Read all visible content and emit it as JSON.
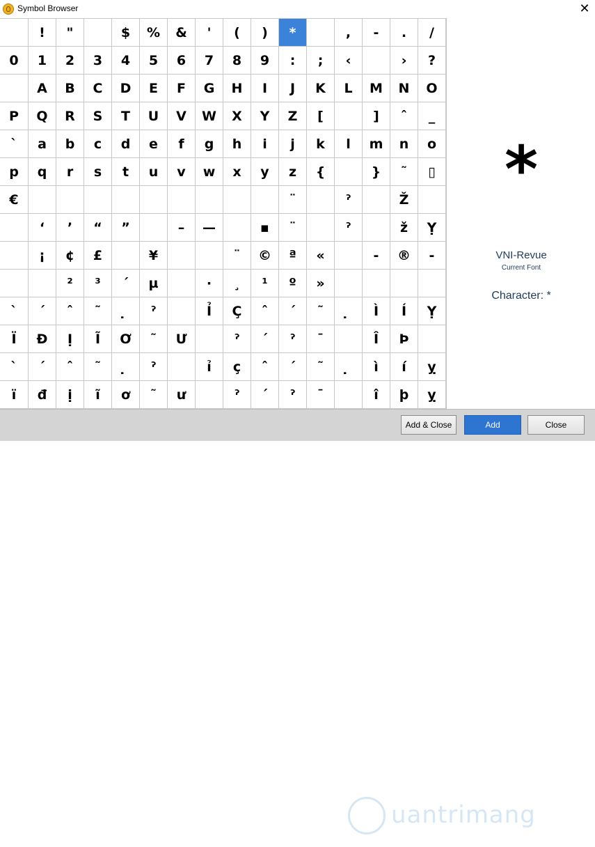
{
  "window": {
    "title": "Symbol Browser",
    "close_glyph": "✕",
    "app_icon": "symbol-browser-app-icon"
  },
  "grid": {
    "selected": {
      "row": 0,
      "col": 10
    },
    "rows": [
      [
        "",
        "!",
        "\"",
        "",
        "$",
        "%",
        "&",
        "'",
        "(",
        ")",
        "*",
        "",
        ",",
        "-",
        ".",
        "/"
      ],
      [
        "0",
        "1",
        "2",
        "3",
        "4",
        "5",
        "6",
        "7",
        "8",
        "9",
        ":",
        ";",
        "‹",
        "",
        "›",
        "?"
      ],
      [
        "",
        "A",
        "B",
        "C",
        "D",
        "E",
        "F",
        "G",
        "H",
        "I",
        "J",
        "K",
        "L",
        "M",
        "N",
        "O"
      ],
      [
        "P",
        "Q",
        "R",
        "S",
        "T",
        "U",
        "V",
        "W",
        "X",
        "Y",
        "Z",
        "[",
        "",
        "]",
        "ˆ",
        "_"
      ],
      [
        "`",
        "a",
        "b",
        "c",
        "d",
        "e",
        "f",
        "g",
        "h",
        "i",
        "j",
        "k",
        "l",
        "m",
        "n",
        "o"
      ],
      [
        "p",
        "q",
        "r",
        "s",
        "t",
        "u",
        "v",
        "w",
        "x",
        "y",
        "z",
        "{",
        "",
        "}",
        "˜",
        "▯"
      ],
      [
        "€",
        "",
        "",
        "",
        "",
        "",
        "",
        "",
        "",
        "",
        "¨",
        "",
        "ˀ",
        "",
        "Ž",
        ""
      ],
      [
        "",
        "‘",
        "’",
        "“",
        "”",
        "",
        "–",
        "—",
        "",
        "▪",
        "¨",
        "",
        "ˀ",
        "",
        "ž",
        "Ỵ"
      ],
      [
        "",
        "¡",
        "¢",
        "£",
        "",
        "¥",
        "",
        "",
        "¨",
        "©",
        "ª",
        "«",
        "",
        "-",
        "®",
        "-"
      ],
      [
        "",
        "",
        "²",
        "³",
        "´",
        "µ",
        "",
        "·",
        "¸",
        "¹",
        "º",
        "»",
        "",
        "",
        "",
        ""
      ],
      [
        "ˋ",
        "ˊ",
        "ˆ",
        "˜",
        "̣",
        "ˀ",
        "",
        "Ỉ",
        "Ç",
        "ˆ",
        "ˊ",
        "˜",
        "̣",
        "Ì",
        "Í",
        "Ỵ"
      ],
      [
        "Ï",
        "Đ",
        "Ị",
        "Ĩ",
        "Ơ",
        "˜",
        "Ư",
        "",
        "ˀ",
        "ˊ",
        "ˀ",
        "ˉ",
        "",
        "Î",
        "Þ",
        ""
      ],
      [
        "ˋ",
        "ˊ",
        "ˆ",
        "˜",
        "̣",
        "ˀ",
        "",
        "ỉ",
        "ç",
        "ˆ",
        "ˊ",
        "˜",
        "̣",
        "ì",
        "í",
        "ỵ"
      ],
      [
        "ï",
        "đ",
        "ị",
        "ĩ",
        "ơ",
        "˜",
        "ư",
        "",
        "ˀ",
        "ˊ",
        "ˀ",
        "ˉ",
        "",
        "î",
        "þ",
        "ỵ"
      ]
    ]
  },
  "preview": {
    "char": "*",
    "font_name": "VNI-Revue",
    "font_caption": "Current Font",
    "character_label": "Character: *"
  },
  "buttons": {
    "add_close": "Add & Close",
    "add": "Add",
    "close": "Close"
  },
  "watermark": {
    "text": "uantrimang"
  },
  "colors": {
    "selected_cell": "#3b82d9",
    "primary_button": "#2e74d1",
    "bottom_bar": "#d4d4d4"
  }
}
